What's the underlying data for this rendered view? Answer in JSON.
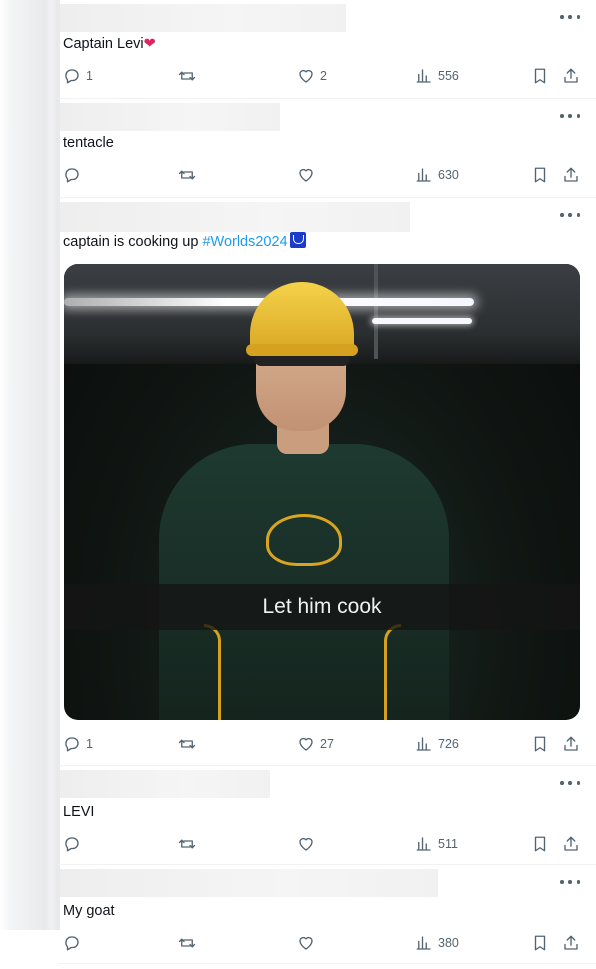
{
  "tweets": [
    {
      "text": "Captain Levi",
      "emoji": "❤️",
      "replies": "1",
      "likes": "2",
      "views": "556"
    },
    {
      "text": "tentacle",
      "replies": "",
      "likes": "",
      "views": "630"
    },
    {
      "text": "captain is cooking up ",
      "hashtag": "#Worlds2024",
      "media_caption": "Let him cook",
      "replies": "1",
      "likes": "27",
      "views": "726"
    },
    {
      "text": "LEVI",
      "replies": "",
      "likes": "",
      "views": "511"
    },
    {
      "text": "My goat",
      "replies": "",
      "likes": "",
      "views": "380"
    }
  ],
  "colors": {
    "hashtag": "#1d9bf0",
    "icon": "#536471",
    "heart": "#e0245e"
  },
  "icons": [
    "reply-icon",
    "retweet-icon",
    "like-icon",
    "views-icon",
    "bookmark-icon",
    "share-icon",
    "more-icon"
  ]
}
